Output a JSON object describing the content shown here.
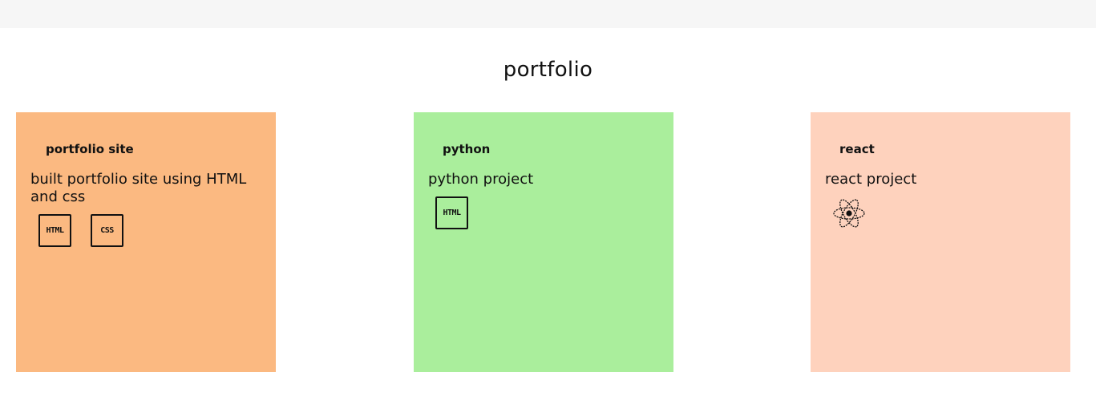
{
  "header": {
    "title": "portfolio"
  },
  "cards": [
    {
      "title": "portfolio site",
      "description": "built portfolio site using HTML and css",
      "color": "#fbb981",
      "badges": [
        "HTML",
        "CSS"
      ]
    },
    {
      "title": "python",
      "description": "python project",
      "color": "#aaee9c",
      "badges": [
        "HTML"
      ]
    },
    {
      "title": "react",
      "description": "react project",
      "color": "#fed2bd",
      "icons": [
        "react-icon"
      ]
    }
  ]
}
